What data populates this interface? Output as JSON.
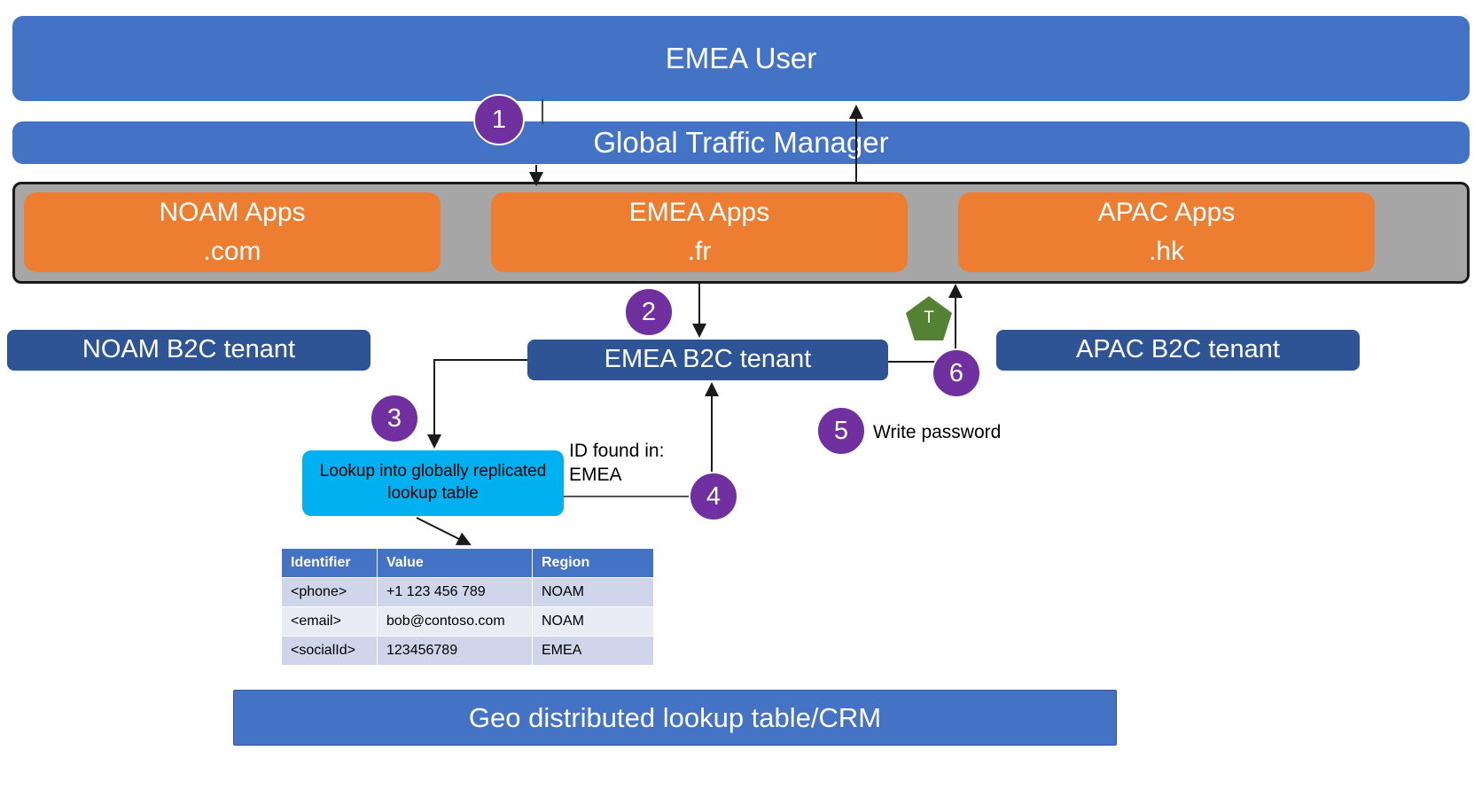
{
  "diagram": {
    "title_bars": {
      "user": "EMEA User",
      "traffic_manager": "Global Traffic Manager"
    },
    "apps": [
      {
        "name": "NOAM Apps",
        "domain": ".com"
      },
      {
        "name": "EMEA Apps",
        "domain": ".fr"
      },
      {
        "name": "APAC Apps",
        "domain": ".hk"
      }
    ],
    "tenants": [
      {
        "label": "NOAM B2C tenant"
      },
      {
        "label": "EMEA B2C tenant"
      },
      {
        "label": "APAC B2C tenant"
      }
    ],
    "lookup_box": "Lookup into globally replicated lookup table",
    "labels": {
      "id_found": "ID found in:\nEMEA",
      "write_password": "Write password"
    },
    "token_badge": "T",
    "steps": [
      {
        "number": "1"
      },
      {
        "number": "2"
      },
      {
        "number": "3"
      },
      {
        "number": "4"
      },
      {
        "number": "5"
      },
      {
        "number": "6"
      }
    ],
    "table": {
      "headers": [
        "Identifier",
        "Value",
        "Region"
      ],
      "rows": [
        [
          "<phone>",
          "+1 123 456 789",
          "NOAM"
        ],
        [
          "<email>",
          "bob@contoso.com",
          "NOAM"
        ],
        [
          "<socialId>",
          "123456789",
          "EMEA"
        ]
      ]
    },
    "crm_bar": "Geo distributed lookup table/CRM",
    "colors": {
      "banner_blue": "#4472C4",
      "app_orange": "#ED7D31",
      "container_gray": "#A6A6A6",
      "tenant_blue": "#2E5496",
      "lookup_cyan": "#00B0F0",
      "step_purple": "#7030A0",
      "token_green": "#548235",
      "table_row_odd": "#CFD5EA",
      "table_row_even": "#E9ECF5"
    }
  }
}
